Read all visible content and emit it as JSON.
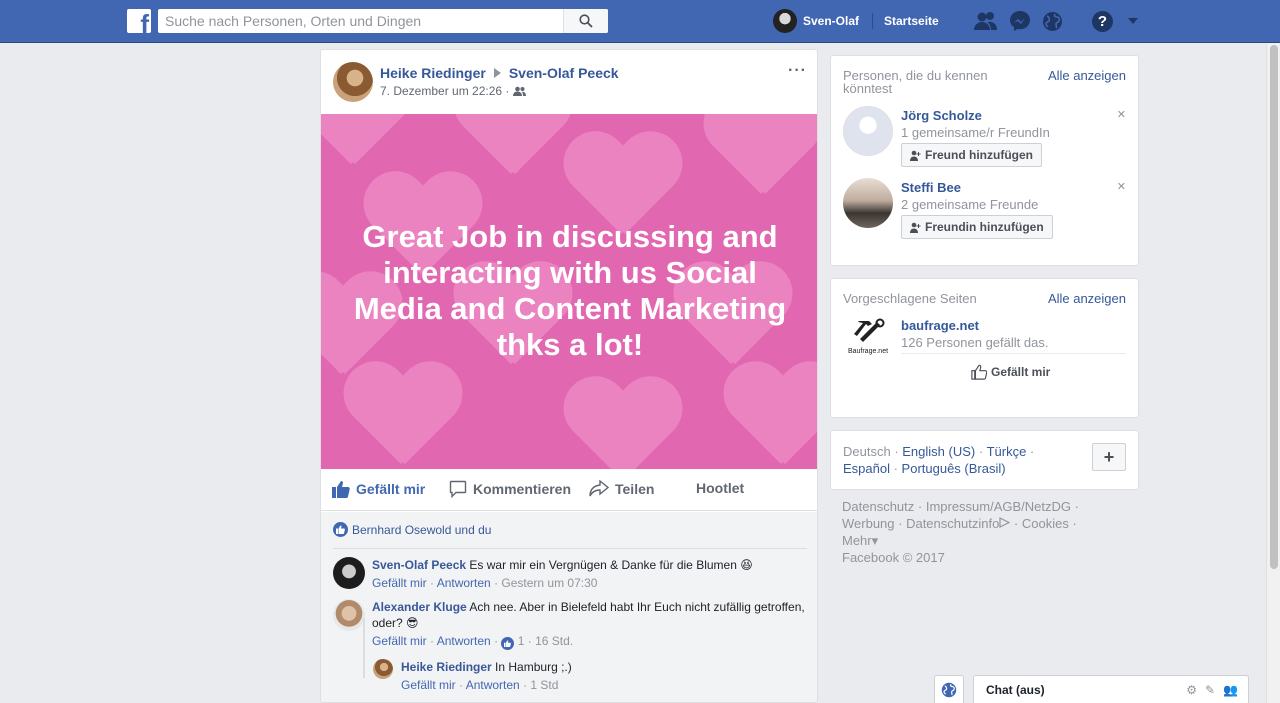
{
  "topbar": {
    "search_placeholder": "Suche nach Personen, Orten und Dingen",
    "user_name": "Sven-Olaf",
    "home": "Startseite",
    "help": "?"
  },
  "post": {
    "author": "Heike Riedinger",
    "target": "Sven-Olaf Peeck",
    "date": "7. Dezember um 22:26 ·",
    "more": "···",
    "banner_text": "Great Job in discussing and interacting with us Social Media and Content Marketing thks a lot!",
    "actions": {
      "like": "Gefällt mir",
      "comment": "Kommentieren",
      "share": "Teilen",
      "hootlet": "Hootlet"
    },
    "likes_summary": "Bernhard Osewold und du",
    "comments": [
      {
        "author": "Sven-Olaf Peeck",
        "text": "Es war mir ein Vergnügen & Danke für die Blumen 😆",
        "like": "Gefällt mir",
        "reply": "Antworten",
        "time": "Gestern um 07:30"
      },
      {
        "author": "Alexander Kluge",
        "text": "Ach nee. Aber in Bielefeld habt Ihr Euch nicht zufällig getroffen, oder? 😎",
        "like": "Gefällt mir",
        "reply": "Antworten",
        "reactions": "1",
        "time": "16 Std."
      },
      {
        "author": "Heike Riedinger",
        "text": "In Hamburg ;.)",
        "like": "Gefällt mir",
        "reply": "Antworten",
        "time": "1 Std"
      }
    ]
  },
  "people_box": {
    "title": "Personen, die du kennen könntest",
    "see_all": "Alle anzeigen",
    "people": [
      {
        "name": "Jörg Scholze",
        "mutual": "1 gemeinsame/r FreundIn",
        "button": "Freund hinzufügen"
      },
      {
        "name": "Steffi Bee",
        "mutual": "2 gemeinsame Freunde",
        "button": "Freundin hinzufügen"
      }
    ]
  },
  "pages_box": {
    "title": "Vorgeschlagene Seiten",
    "see_all": "Alle anzeigen",
    "page_name": "baufrage.net",
    "page_logo_text": "Baufrage.net",
    "page_likes": "126 Personen gefällt das.",
    "like_button": "Gefällt mir"
  },
  "languages": {
    "current": "Deutsch",
    "options": [
      "English (US)",
      "Türkçe",
      "Español",
      "Português (Brasil)"
    ]
  },
  "footer": {
    "links": [
      "Datenschutz",
      "Impressum/AGB/NetzDG",
      "Werbung",
      "Datenschutzinfo",
      "Cookies",
      "Mehr"
    ],
    "copyright": "Facebook © 2017"
  },
  "chat": {
    "label": "Chat (aus)"
  },
  "colors": {
    "brand_blue": "#4267b2",
    "banner_pink": "#e167b0",
    "link": "#365899"
  }
}
